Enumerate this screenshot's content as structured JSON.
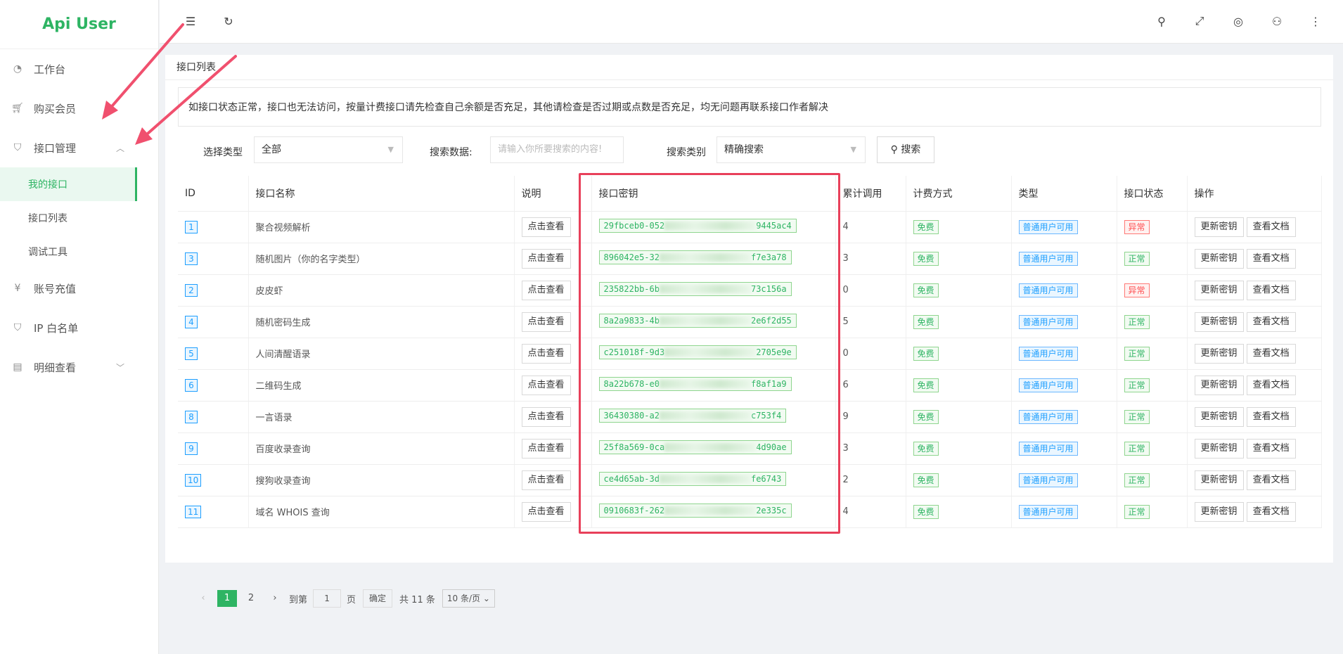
{
  "brand": "Api User",
  "colors": {
    "accent": "#2eb463",
    "highlight_box": "#e8405a",
    "info": "#1e9fff",
    "danger": "#ff4d4f"
  },
  "sidebar": {
    "items": [
      {
        "label": "工作台",
        "icon": "dashboard-icon"
      },
      {
        "label": "购买会员",
        "icon": "cart-icon"
      },
      {
        "label": "接口管理",
        "icon": "shield-icon"
      },
      {
        "label": "账号充值",
        "icon": "yen-icon"
      },
      {
        "label": "IP 白名单",
        "icon": "shield-icon"
      },
      {
        "label": "明细查看",
        "icon": "chart-icon"
      }
    ],
    "subitems": [
      "我的接口",
      "接口列表",
      "调试工具"
    ]
  },
  "card": {
    "title": "接口列表",
    "notice": "如接口状态正常，接口也无法访问，按量计费接口请先检查自己余额是否充足，其他请检查是否过期或点数是否充足，均无问题再联系接口作者解决"
  },
  "filters": {
    "type_label": "选择类型",
    "type_value": "全部",
    "search_label": "搜索数据:",
    "search_placeholder": "请输入你所要搜索的内容!",
    "category_label": "搜索类别",
    "category_value": "精确搜索",
    "search_button": "搜索"
  },
  "table": {
    "headers": [
      "ID",
      "接口名称",
      "说明",
      "接口密钥",
      "累计调用",
      "计费方式",
      "类型",
      "接口状态",
      "操作"
    ],
    "view_label": "点击查看",
    "refresh_label": "更新密钥",
    "docs_label": "查看文档",
    "rows": [
      {
        "id": "1",
        "name": "聚合视频解析",
        "key_head": "29fbceb0-052",
        "key_tail": "9445ac4",
        "calls": "4",
        "billing": "免费",
        "type": "普通用户可用",
        "status": "异常"
      },
      {
        "id": "3",
        "name": "随机图片（你的名字类型）",
        "key_head": "896042e5-32",
        "key_tail": "f7e3a78",
        "calls": "3",
        "billing": "免费",
        "type": "普通用户可用",
        "status": "正常"
      },
      {
        "id": "2",
        "name": "皮皮虾",
        "key_head": "235822bb-6b",
        "key_tail": "73c156a",
        "calls": "0",
        "billing": "免费",
        "type": "普通用户可用",
        "status": "异常"
      },
      {
        "id": "4",
        "name": "随机密码生成",
        "key_head": "8a2a9833-4b",
        "key_tail": "2e6f2d55",
        "calls": "5",
        "billing": "免费",
        "type": "普通用户可用",
        "status": "正常"
      },
      {
        "id": "5",
        "name": "人间清醒语录",
        "key_head": "c251018f-9d3",
        "key_tail": "2705e9e",
        "calls": "0",
        "billing": "免费",
        "type": "普通用户可用",
        "status": "正常"
      },
      {
        "id": "6",
        "name": "二维码生成",
        "key_head": "8a22b678-e0",
        "key_tail": "f8af1a9",
        "calls": "6",
        "billing": "免费",
        "type": "普通用户可用",
        "status": "正常"
      },
      {
        "id": "8",
        "name": "一言语录",
        "key_head": "36430380-a2",
        "key_tail": "c753f4",
        "calls": "9",
        "billing": "免费",
        "type": "普通用户可用",
        "status": "正常"
      },
      {
        "id": "9",
        "name": "百度收录查询",
        "key_head": "25f8a569-0ca",
        "key_tail": "4d90ae",
        "calls": "3",
        "billing": "免费",
        "type": "普通用户可用",
        "status": "正常"
      },
      {
        "id": "10",
        "name": "搜狗收录查询",
        "key_head": "ce4d65ab-3d",
        "key_tail": "fe6743",
        "calls": "2",
        "billing": "免费",
        "type": "普通用户可用",
        "status": "正常"
      },
      {
        "id": "11",
        "name": "域名 WHOIS 查询",
        "key_head": "0910683f-262",
        "key_tail": "2e335c",
        "calls": "4",
        "billing": "免费",
        "type": "普通用户可用",
        "status": "正常"
      }
    ]
  },
  "pager": {
    "pages": [
      "1",
      "2"
    ],
    "current": "1",
    "goto_label": "到第",
    "goto_value": "1",
    "page_suffix": "页",
    "confirm": "确定",
    "total": "共 11 条",
    "size": "10 条/页"
  }
}
